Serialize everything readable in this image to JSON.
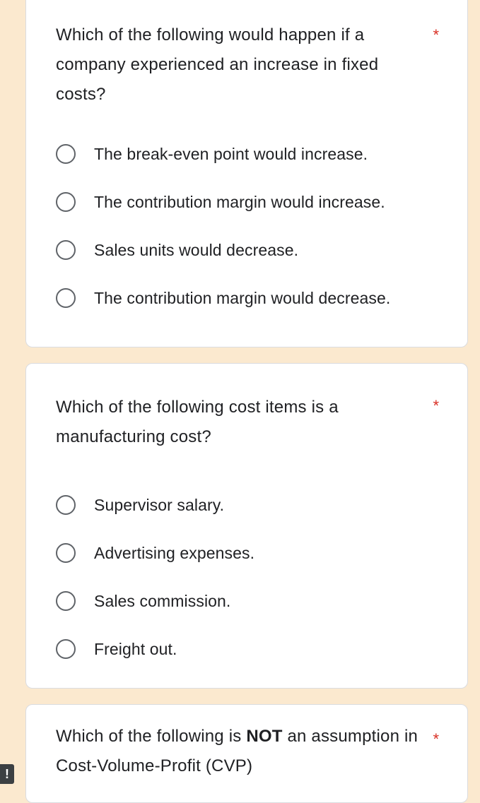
{
  "questions": [
    {
      "text": "Which of the following would happen if a company experienced an increase in fixed costs?",
      "required_mark": "*",
      "options": [
        "The break-even point would increase.",
        "The contribution margin would increase.",
        "Sales units would decrease.",
        "The contribution margin would decrease."
      ]
    },
    {
      "text": "Which of the following cost items is a manufacturing cost?",
      "required_mark": "*",
      "options": [
        "Supervisor salary.",
        "Advertising expenses.",
        "Sales commission.",
        "Freight out."
      ]
    },
    {
      "text_before": "Which of the following is ",
      "text_bold": "NOT",
      "text_after": " an assumption in Cost-Volume-Profit (CVP)",
      "required_mark": "*"
    }
  ],
  "alert_badge": "!",
  "colors": {
    "background": "#fbe9cf",
    "card": "#ffffff",
    "required": "#d93025",
    "radio_border": "#5f6368"
  }
}
